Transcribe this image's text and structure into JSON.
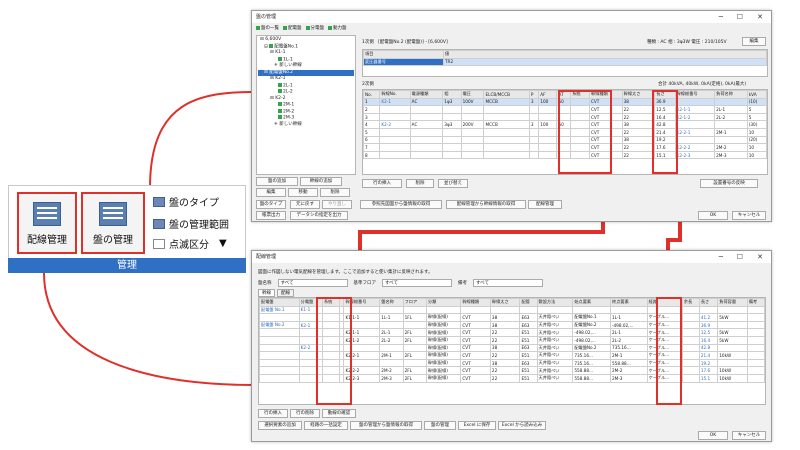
{
  "ribbon": {
    "group_label": "管理",
    "big_buttons": [
      {
        "label": "配線管理"
      },
      {
        "label": "盤の管理"
      }
    ],
    "small_items": [
      {
        "label": "盤のタイプ"
      },
      {
        "label": "盤の管理範囲"
      },
      {
        "label": "点滅区分"
      }
    ]
  },
  "panel_window": {
    "title": "盤の管理",
    "toolbar": [
      "盤の一覧",
      "配電盤",
      "分電盤",
      "動力盤"
    ],
    "tree": [
      "6,600V",
      "配電盤No.1",
      "K1-1",
      "1L-1",
      "新しい幹線",
      "配電盤No.2",
      "K2-1",
      "2L-1",
      "2L-2",
      "K2-2",
      "2M-1",
      "2M-2",
      "2M-3",
      "新しい幹線"
    ],
    "primary_label": "1次側",
    "primary_header": "[配電盤No.2 (配電盤)] - [6,600V]",
    "primary_info": "種類 : AC  相 : 3φ3W  電圧 : 210/105V",
    "edit_button": "編集",
    "primary_rows": [
      [
        "項目",
        "値"
      ],
      [
        "変圧器番号",
        "TR2"
      ]
    ],
    "secondary_label": "2次側",
    "totals": "合計 40kVA, 40kW, 0kA(定格), 0kA(最大)",
    "columns": [
      "No.",
      "幹線No.",
      "電源種類",
      "相",
      "電圧",
      "ELCB/MCCB",
      "P",
      "AF",
      "AT",
      "系統",
      "幹線種類",
      "幹線太さ",
      "長さ",
      "幹線総番号",
      "負荷名称",
      "kVA"
    ],
    "rows": [
      [
        "1",
        "K2-1",
        "AC",
        "1φ3",
        "100V",
        "MCCB",
        "3",
        "100",
        "50",
        "",
        "CVT",
        "38",
        "36.9",
        "",
        "",
        "(10)"
      ],
      [
        "2",
        "",
        "",
        "",
        "",
        "",
        "",
        "",
        "",
        "",
        "CVT",
        "22",
        "12.5",
        "K2-1-1",
        "2L-1",
        "5"
      ],
      [
        "3",
        "",
        "",
        "",
        "",
        "",
        "",
        "",
        "",
        "",
        "CVT",
        "22",
        "16.4",
        "K2-1-2",
        "2L-2",
        "5"
      ],
      [
        "4",
        "K2-2",
        "AC",
        "3φ3",
        "200V",
        "MCCB",
        "3",
        "100",
        "50",
        "",
        "CVT",
        "38",
        "42.8",
        "",
        "",
        "(30)"
      ],
      [
        "5",
        "",
        "",
        "",
        "",
        "",
        "",
        "",
        "",
        "",
        "CVT",
        "22",
        "21.4",
        "K2-2-1",
        "2M-1",
        "10"
      ],
      [
        "6",
        "",
        "",
        "",
        "",
        "",
        "",
        "",
        "",
        "",
        "CVT",
        "38",
        "19.2",
        "",
        "",
        "(20)"
      ],
      [
        "7",
        "",
        "",
        "",
        "",
        "",
        "",
        "",
        "",
        "",
        "CVT",
        "22",
        "17.6",
        "K2-2-2",
        "2M-2",
        "10"
      ],
      [
        "8",
        "",
        "",
        "",
        "",
        "",
        "",
        "",
        "",
        "",
        "CVT",
        "22",
        "15.1",
        "K2-2-3",
        "2M-3",
        "10"
      ]
    ],
    "left_buttons": [
      "盤の追加",
      "幹線の追加",
      "編集",
      "移動",
      "削除"
    ],
    "row_buttons": [
      "行の挿入",
      "削除",
      "並び替え"
    ],
    "reflect_button": "設置番号の反映",
    "bottom_buttons": [
      "盤のタイプ",
      "元に戻す",
      "やり直し",
      "参照先図面から盤情報の取得",
      "配線管理から幹線情報の取得",
      "配線管理"
    ],
    "bottom_buttons2": [
      "帳票出力",
      "データシの指定を出力"
    ],
    "ok": "OK",
    "cancel": "キャンセル"
  },
  "wiring_window": {
    "title": "配線管理",
    "instruction": "図面に作図しない電気配線を管理します。ここで追加すると使い集計に反映されます。",
    "filter_labels": [
      "盤名称",
      "基準フロア",
      "備考"
    ],
    "filter_values": [
      "すべて",
      "すべて",
      "すべて"
    ],
    "tabs": [
      "幹線",
      "配線"
    ],
    "columns": [
      "配電盤",
      "分電盤",
      "系統",
      "",
      "幹線総番号",
      "盤名称",
      "フロア",
      "分類",
      "幹線種類",
      "幹線太さ",
      "配管",
      "敷設方法",
      "始点要素",
      "終点要素",
      "経路",
      "余長",
      "長さ",
      "負荷容量",
      "備考"
    ],
    "rows": [
      [
        "配電盤 No.1",
        "K1-1",
        "",
        "",
        "",
        "",
        "",
        "",
        "",
        "",
        "",
        "",
        "",
        "",
        "",
        "",
        "",
        "",
        ""
      ],
      [
        "",
        "",
        "",
        "",
        "K1-1-1",
        "1L-1",
        "1FL",
        "幹線(配線)",
        "CVT",
        "38",
        "E63",
        "天井隠ぺい",
        "配電盤No.1",
        "1L-1",
        "ケーブル...",
        "",
        "41.2",
        "5kW",
        ""
      ],
      [
        "配電盤 No.2",
        "K2-1",
        "",
        "",
        "",
        "",
        "",
        "幹線(配線)",
        "CVT",
        "38",
        "E63",
        "天井隠ぺい",
        "配電盤No.2",
        "-498.02,...",
        "ケーブル...",
        "",
        "36.9",
        "",
        ""
      ],
      [
        "",
        "",
        "",
        "",
        "K2-1-1",
        "2L-1",
        "2FL",
        "幹線(配線)",
        "CVT",
        "22",
        "E51",
        "天井隠ぺい",
        "-498.02,...",
        "2L-1",
        "ケーブル...",
        "",
        "12.5",
        "5kW",
        ""
      ],
      [
        "",
        "",
        "",
        "",
        "K2-1-2",
        "2L-2",
        "2FL",
        "幹線(配線)",
        "CVT",
        "22",
        "E51",
        "天井隠ぺい",
        "-498.02,...",
        "2L-2",
        "ケーブル...",
        "",
        "16.4",
        "5kW",
        ""
      ],
      [
        "",
        "K2-2",
        "",
        "",
        "",
        "",
        "",
        "幹線(配線)",
        "CVT",
        "38",
        "E63",
        "天井隠ぺい",
        "配電盤No.2",
        "735.16...",
        "ケーブル...",
        "",
        "42.8",
        "",
        ""
      ],
      [
        "",
        "",
        "",
        "",
        "K2-2-1",
        "2M-1",
        "2FL",
        "幹線(配線)",
        "CVT",
        "22",
        "E51",
        "天井隠ぺい",
        "735.16...",
        "2M-1",
        "ケーブル...",
        "",
        "21.4",
        "10kW",
        ""
      ],
      [
        "",
        "",
        "",
        "",
        "",
        "",
        "",
        "幹線(配線)",
        "CVT",
        "38",
        "E63",
        "天井隠ぺい",
        "735.16...",
        "558.88...",
        "ケーブル...",
        "",
        "19.2",
        "",
        ""
      ],
      [
        "",
        "",
        "",
        "",
        "K2-2-2",
        "2M-2",
        "2FL",
        "幹線(配線)",
        "CVT",
        "22",
        "E51",
        "天井隠ぺい",
        "558.88...",
        "2M-2",
        "ケーブル...",
        "",
        "17.6",
        "10kW",
        ""
      ],
      [
        "",
        "",
        "",
        "",
        "K2-2-3",
        "2M-3",
        "2FL",
        "幹線(配線)",
        "CVT",
        "22",
        "E51",
        "天井隠ぺい",
        "558.88...",
        "2M-3",
        "ケーブル...",
        "",
        "15.1",
        "10kW",
        ""
      ]
    ],
    "row_buttons": [
      "行の挿入",
      "行の削除",
      "動線の確認"
    ],
    "bottom_buttons": [
      "選択要素の追加",
      "経路の一括設定",
      "盤の管理から盤情報の取得",
      "盤の管理",
      "Excel に保存",
      "Excel から読み込み"
    ],
    "ok": "OK",
    "cancel": "キャンセル"
  },
  "colors": {
    "accent_red": "#e0302a",
    "ribbon_blue": "#2f6fc4",
    "selection": "#cfe0f7"
  }
}
